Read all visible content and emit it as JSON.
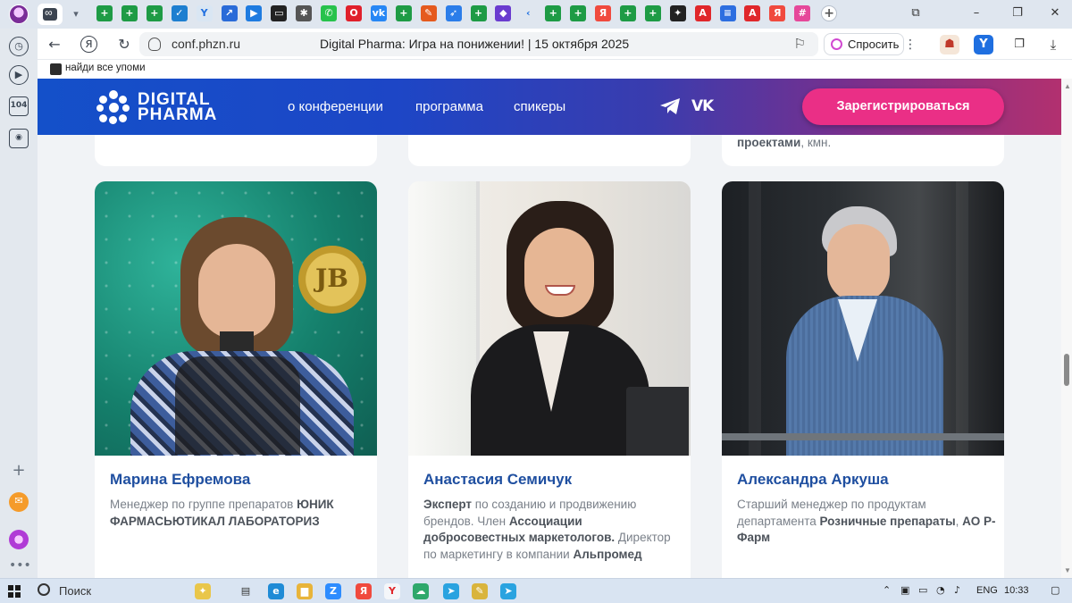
{
  "browser": {
    "address": {
      "domain": "conf.phzn.ru",
      "page_title": "Digital Pharma: Игра на понижении! | 15 октября 2025"
    },
    "ask_button_label": "Спросить",
    "bookmark": {
      "label": "найди все упоми"
    },
    "sidebar_badge": "104",
    "tab_icons": [
      {
        "name": "sheets",
        "color": "#1e9b45",
        "glyph": "+"
      },
      {
        "name": "sheets",
        "color": "#1e9b45",
        "glyph": "+"
      },
      {
        "name": "sheets",
        "color": "#1e9b45",
        "glyph": "+"
      },
      {
        "name": "check",
        "color": "#1e7fd0",
        "glyph": "✓"
      },
      {
        "name": "yandex-y",
        "color": "#d9e6f3",
        "glyph": "Y"
      },
      {
        "name": "arrow",
        "color": "#2a6bd8",
        "glyph": "↗"
      },
      {
        "name": "zoom",
        "color": "#1e7be0",
        "glyph": "▶"
      },
      {
        "name": "camera",
        "color": "#222222",
        "glyph": "▭"
      },
      {
        "name": "gear",
        "color": "#555555",
        "glyph": "✱"
      },
      {
        "name": "whatsapp",
        "color": "#27c24c",
        "glyph": "✆"
      },
      {
        "name": "opera",
        "color": "#e0202b",
        "glyph": "O"
      },
      {
        "name": "vk",
        "color": "#2787f5",
        "glyph": "vk"
      },
      {
        "name": "sheets",
        "color": "#1e9b45",
        "glyph": "+"
      },
      {
        "name": "flame",
        "color": "#e55a1e",
        "glyph": "✎"
      },
      {
        "name": "feather",
        "color": "#2b7de9",
        "glyph": "➶"
      },
      {
        "name": "sheets",
        "color": "#1e9b45",
        "glyph": "+"
      },
      {
        "name": "shield",
        "color": "#6a3ccf",
        "glyph": "◆"
      },
      {
        "name": "back",
        "color": "#dfe6ef",
        "glyph": "‹"
      },
      {
        "name": "sheets",
        "color": "#1e9b45",
        "glyph": "+"
      },
      {
        "name": "sheets",
        "color": "#1e9b45",
        "glyph": "+"
      },
      {
        "name": "yandex",
        "color": "#f04a3e",
        "glyph": "Я"
      },
      {
        "name": "sheets",
        "color": "#1e9b45",
        "glyph": "+"
      },
      {
        "name": "sheets",
        "color": "#1e9b45",
        "glyph": "+"
      },
      {
        "name": "spark",
        "color": "#222222",
        "glyph": "✦"
      },
      {
        "name": "acrobat",
        "color": "#e0272b",
        "glyph": "A"
      },
      {
        "name": "docs",
        "color": "#2d6ee0",
        "glyph": "≡"
      },
      {
        "name": "acrobat",
        "color": "#e0272b",
        "glyph": "A"
      },
      {
        "name": "yandex",
        "color": "#f04a3e",
        "glyph": "Я"
      },
      {
        "name": "grid",
        "color": "#e6489a",
        "glyph": "#"
      }
    ]
  },
  "site": {
    "logo_line1": "DIGITAL",
    "logo_line2": "PHARMA",
    "nav": [
      "о конференции",
      "программа",
      "спикеры"
    ],
    "register_label": "Зарегистрироваться",
    "colors": {
      "header_start": "#1450c9",
      "header_end": "#b2306f",
      "accent_pink": "#ea2f86",
      "name_blue": "#1f4fa0"
    }
  },
  "top_card_fragment": {
    "bold": "проектами",
    "rest": ", кмн."
  },
  "speakers": [
    {
      "name": "Марина Ефремова",
      "desc": [
        {
          "t": "Менеджер по группе препаратов ",
          "b": false
        },
        {
          "t": "ЮНИК ФАРМАСЬЮТИКАЛ ЛАБОРАТОРИЗ",
          "b": true
        }
      ]
    },
    {
      "name": "Анастасия Семичук",
      "desc": [
        {
          "t": "Эксперт",
          "b": true
        },
        {
          "t": " по созданию и продвижению брендов. Член ",
          "b": false
        },
        {
          "t": "Ассоциации добросовестных маркетологов.",
          "b": true
        },
        {
          "t": " Директор по маркетингу в компании ",
          "b": false
        },
        {
          "t": "Альпромед",
          "b": true
        }
      ]
    },
    {
      "name": "Александра Аркуша",
      "desc": [
        {
          "t": "Старший менеджер по продуктам департамента ",
          "b": false
        },
        {
          "t": "Розничные препараты",
          "b": true
        },
        {
          "t": ", ",
          "b": false
        },
        {
          "t": "АО Р-Фарм",
          "b": true
        }
      ]
    }
  ],
  "photo_texts": {
    "medal": "JB"
  },
  "taskbar": {
    "search_label": "Поиск",
    "apps": [
      {
        "name": "copilot",
        "color": "#e9c64a",
        "glyph": "✦"
      },
      {
        "name": "task-view",
        "color": "#333333",
        "glyph": "▤"
      },
      {
        "name": "edge",
        "color": "#1f8bd6",
        "glyph": "e"
      },
      {
        "name": "explorer",
        "color": "#e8b43a",
        "glyph": "▆"
      },
      {
        "name": "zoom",
        "color": "#2d8cff",
        "glyph": "Z"
      },
      {
        "name": "yandex",
        "color": "#f04a3e",
        "glyph": "Я"
      },
      {
        "name": "yandex-browser",
        "color": "#f4f6f9",
        "glyph": "Y"
      },
      {
        "name": "cloud",
        "color": "#2ea86b",
        "glyph": "☁"
      },
      {
        "name": "telegram",
        "color": "#2aa3e0",
        "glyph": "➤"
      },
      {
        "name": "paint",
        "color": "#d9b43c",
        "glyph": "✎"
      },
      {
        "name": "telegram",
        "color": "#2aa3e0",
        "glyph": "➤"
      }
    ],
    "lang": "ENG",
    "time": "10:33"
  }
}
